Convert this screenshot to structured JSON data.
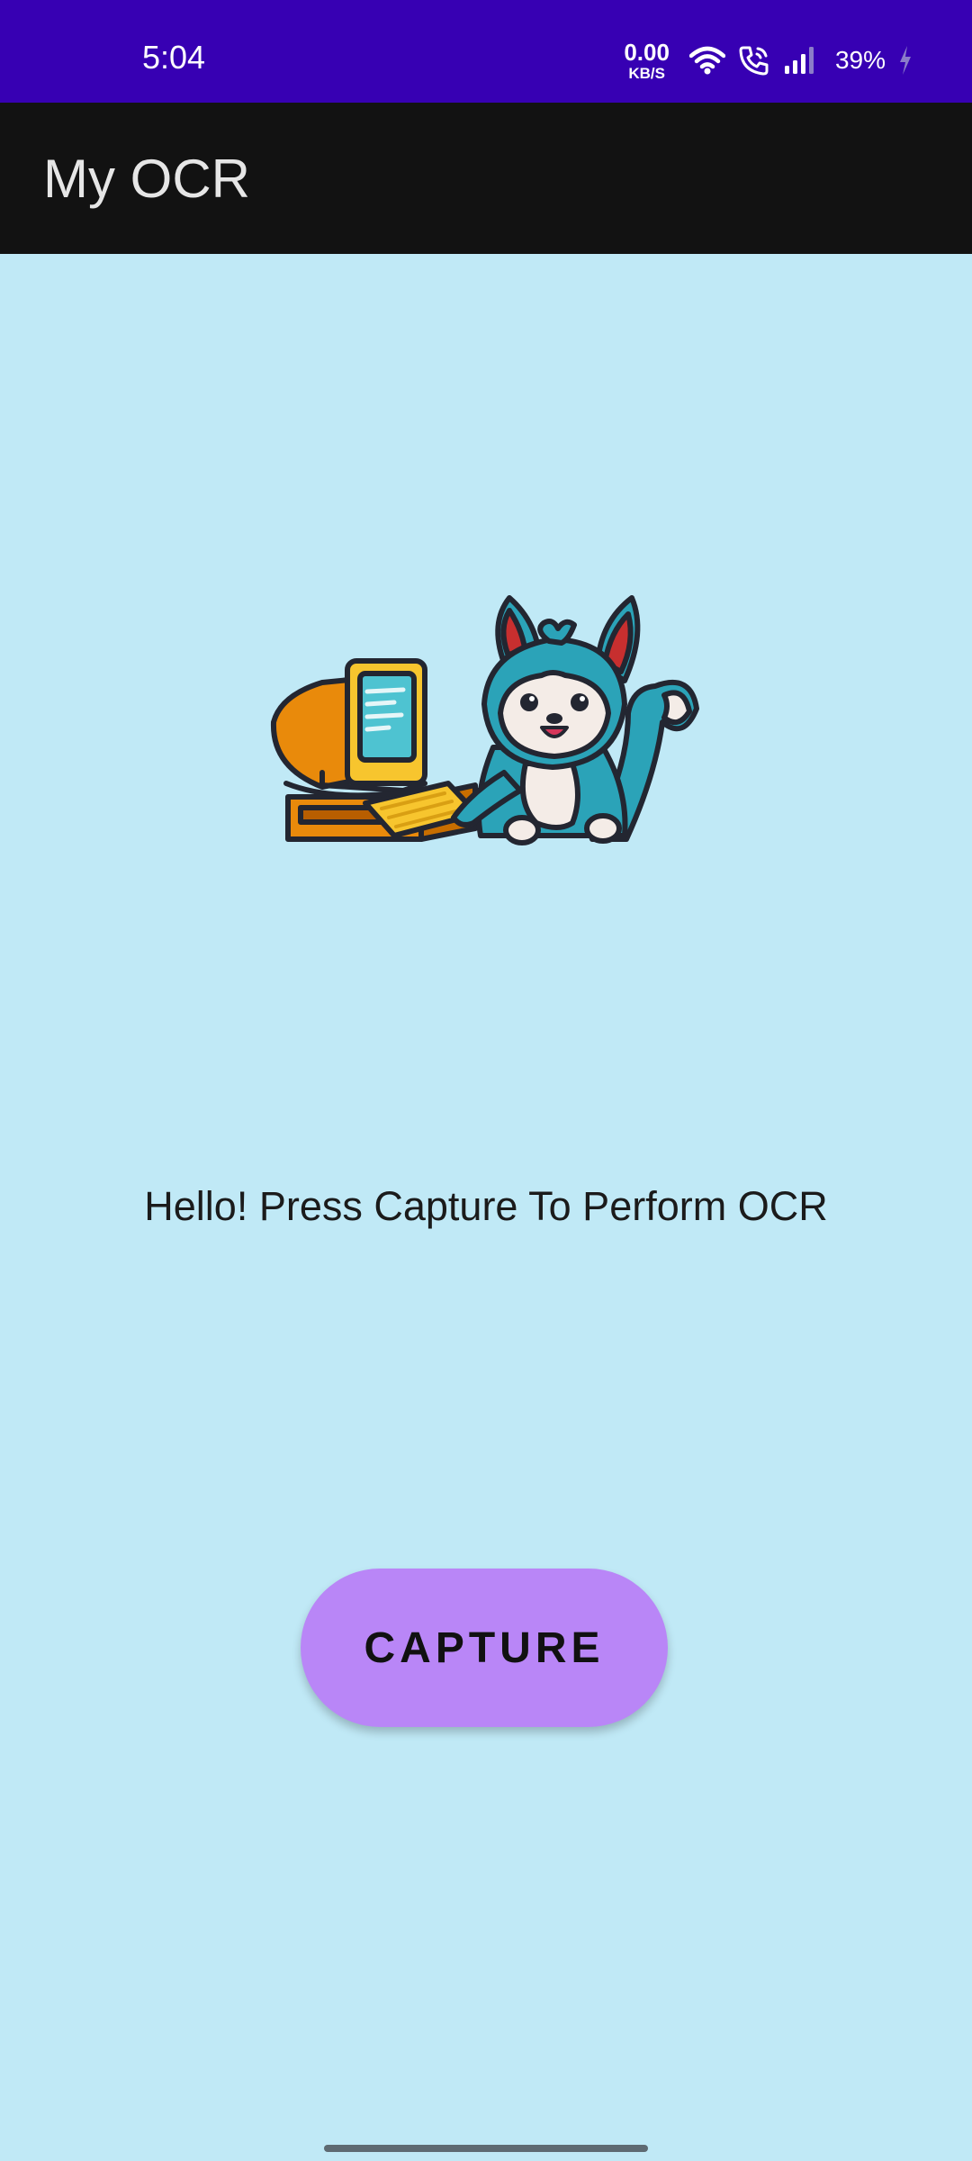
{
  "status_bar": {
    "time": "5:04",
    "net_speed_value": "0.00",
    "net_speed_unit": "KB/S",
    "battery": "39%",
    "icons": [
      "wifi-icon",
      "wifi-calling-icon",
      "signal-icon",
      "battery-charging-icon"
    ],
    "background": "#3700b3"
  },
  "app_bar": {
    "title": "My OCR",
    "background": "#121212"
  },
  "main": {
    "illustration": "mascot-computer-image",
    "message": "Hello! Press Capture To Perform OCR",
    "capture_label": "CAPTURE",
    "background": "#c0e9f6",
    "button_color": "#b986f7"
  }
}
